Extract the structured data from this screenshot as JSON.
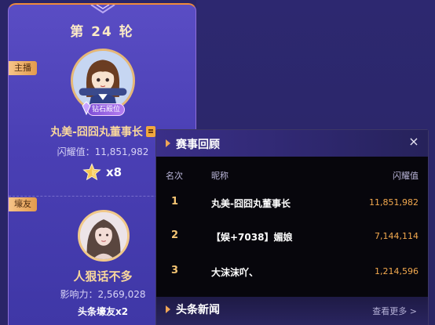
{
  "round": {
    "title": "第 24 轮"
  },
  "host": {
    "tag": "主播",
    "badge": "钻石殿位",
    "name": "丸美-囧囧丸董事长",
    "score_label": "闪耀值：11,851,982",
    "stars": "x8"
  },
  "fan": {
    "tag": "壕友",
    "name": "人狠话不多",
    "influence_label": "影响力：2,569,028",
    "title": "头条壕友x2"
  },
  "panel": {
    "title": "赛事回顾",
    "close": "×",
    "columns": {
      "rank": "名次",
      "nickname": "昵称",
      "score": "闪耀值"
    },
    "rows": [
      {
        "rank": "1",
        "nickname": "丸美-囧囧丸董事长",
        "score": "11,851,982"
      },
      {
        "rank": "2",
        "nickname": "【娱+7038】媚娘",
        "score": "7,144,114"
      },
      {
        "rank": "3",
        "nickname": "大沫沫吖、",
        "score": "1,214,596"
      }
    ],
    "news_title": "头条新闻",
    "more": "查看更多 >"
  },
  "colors": {
    "accent": "#f0a656",
    "gold_text": "#f8d79c",
    "score_orange": "#f2a84e",
    "card_purple": "#4a3fb4",
    "panel_bg": "#07060c"
  }
}
